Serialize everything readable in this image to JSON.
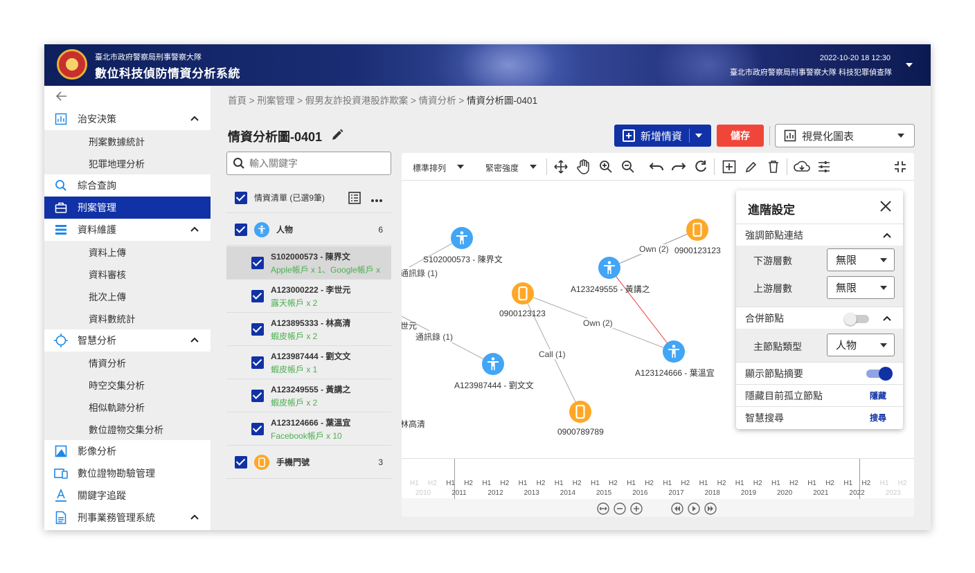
{
  "header": {
    "org": "臺北市政府警察局刑事警察大隊",
    "system": "數位科技偵防情資分析系統",
    "datetime": "2022-10-20 18  12:30",
    "unit": "臺北市政府警察局刑事警察大隊 科技犯罪偵查隊"
  },
  "sidebar": {
    "items": [
      {
        "label": "治安決策",
        "icon": "bar-chart-icon"
      },
      {
        "label": "刑案數據統計"
      },
      {
        "label": "犯罪地理分析"
      },
      {
        "label": "綜合查詢",
        "icon": "search-icon"
      },
      {
        "label": "刑案管理",
        "icon": "briefcase-icon"
      },
      {
        "label": "資料維護",
        "icon": "list-icon"
      },
      {
        "label": "資料上傳"
      },
      {
        "label": "資料審核"
      },
      {
        "label": "批次上傳"
      },
      {
        "label": "資料數統計"
      },
      {
        "label": "智慧分析",
        "icon": "crosshair-icon"
      },
      {
        "label": "情資分析"
      },
      {
        "label": "時空交集分析"
      },
      {
        "label": "相似軌跡分析"
      },
      {
        "label": "數位證物交集分析"
      },
      {
        "label": "影像分析",
        "icon": "image-icon"
      },
      {
        "label": "數位證物勘驗管理",
        "icon": "device-icon"
      },
      {
        "label": "關鍵字追蹤",
        "icon": "text-icon"
      },
      {
        "label": "刑事業務管理系統",
        "icon": "document-icon"
      }
    ]
  },
  "breadcrumb": {
    "path": "首頁 > 刑案管理 > 假男友詐投資港股詐欺案 > 情資分析 > ",
    "current": "情資分析圖-0401"
  },
  "page": {
    "title": "情資分析圖-0401",
    "add_label": "新增情資",
    "save_label": "儲存",
    "viz_label": "視覺化圖表"
  },
  "search": {
    "placeholder": "輸入關鍵字"
  },
  "list": {
    "header": "情資清單 (已選9筆)",
    "group_person": {
      "label": "人物",
      "count": "6"
    },
    "group_phone": {
      "label": "手機門號",
      "count": "3"
    },
    "persons": [
      {
        "id": "S102000573 - 陳界文",
        "detail": "Apple帳戶 x 1、Google帳戶 x"
      },
      {
        "id": "A123000222 - 李世元",
        "detail": "露天帳戶 x 2"
      },
      {
        "id": "A123895333 - 林高清",
        "detail": "蝦皮帳戶 x 2"
      },
      {
        "id": "A123987444 - 劉文文",
        "detail": "蝦皮帳戶 x 1"
      },
      {
        "id": "A123249555 - 黃講之",
        "detail": "蝦皮帳戶 x 2"
      },
      {
        "id": "A123124666 - 葉溫宜",
        "detail": "Facebook帳戶 x 10"
      }
    ]
  },
  "toolbar": {
    "layout_label": "標準排列",
    "density_label": "緊密強度"
  },
  "graph": {
    "nodes": {
      "n1": "S102000573 - 陳界文",
      "n2": "0900123123",
      "n3": "A123249555 - 黃講之",
      "n4": "0900123123",
      "n5": "A123987444 - 劉文文",
      "n6": "A123124666 - 葉溫宜",
      "n7": "0900789789",
      "n8": "世元",
      "n9": "林高清"
    },
    "edges": {
      "e1": "通訊錄 (1)",
      "e2": "Own (2)",
      "e3": "通訊錄 (1)",
      "e4": "Own (2)",
      "e5": "Call (1)"
    },
    "colors": {
      "person": "#42a5f5",
      "phone": "#ffa726",
      "highlight": "#e53935",
      "edge": "#aaaaaa"
    }
  },
  "advanced": {
    "title": "進階設定",
    "highlight_links": "強調節點連結",
    "downstream_label": "下游層數",
    "downstream_value": "無限",
    "upstream_label": "上游層數",
    "upstream_value": "無限",
    "merge_label": "合併節點",
    "merge_on": false,
    "main_type_label": "主節點類型",
    "main_type_value": "人物",
    "show_summary_label": "顯示節點摘要",
    "show_summary_on": true,
    "hide_isolated_label": "隱藏目前孤立節點",
    "hide_isolated_action": "隱藏",
    "smart_search_label": "智慧搜尋",
    "smart_search_action": "搜尋"
  },
  "timeline": {
    "halves": [
      "H1",
      "H2"
    ],
    "years": [
      "2010",
      "2011",
      "2012",
      "2013",
      "2014",
      "2015",
      "2016",
      "2017",
      "2018",
      "2019",
      "2020",
      "2021",
      "2022",
      "2023"
    ]
  }
}
